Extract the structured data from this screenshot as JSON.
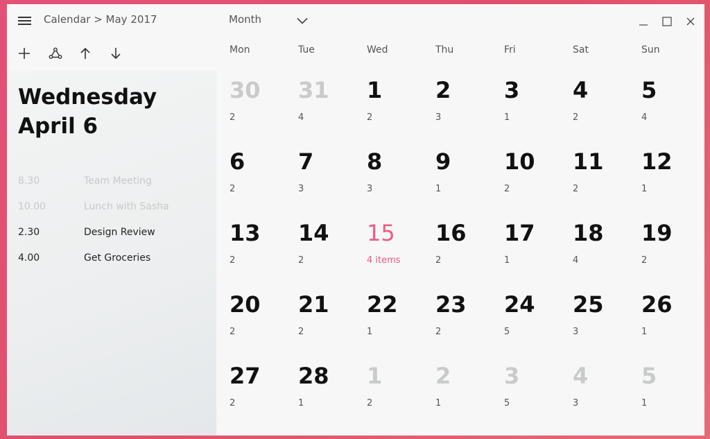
{
  "app": {
    "breadcrumb": "Calendar > May 2017",
    "view_label": "Month"
  },
  "toolbar": {
    "add_icon": "plus-icon",
    "share_icon": "share-icon",
    "up_icon": "arrow-up-icon",
    "down_icon": "arrow-down-icon"
  },
  "window_controls": [
    "minimize-icon",
    "maximize-icon",
    "close-icon"
  ],
  "day": {
    "weekday": "Wednesday",
    "date": "April 6"
  },
  "events": [
    {
      "time": "8.30",
      "title": "Team Meeting",
      "state": "past"
    },
    {
      "time": "10.00",
      "title": "Lunch with Sasha",
      "state": "past"
    },
    {
      "time": "2.30",
      "title": "Design Review",
      "state": "upcoming"
    },
    {
      "time": "4.00",
      "title": "Get Groceries",
      "state": "upcoming"
    }
  ],
  "weekdays": [
    "Mon",
    "Tue",
    "Wed",
    "Thu",
    "Fri",
    "Sat",
    "Sun"
  ],
  "weeks": [
    [
      {
        "day": "30",
        "count": "2",
        "other": true
      },
      {
        "day": "31",
        "count": "4",
        "other": true
      },
      {
        "day": "1",
        "count": "2"
      },
      {
        "day": "2",
        "count": "3"
      },
      {
        "day": "3",
        "count": "1"
      },
      {
        "day": "4",
        "count": "2"
      },
      {
        "day": "5",
        "count": "4"
      }
    ],
    [
      {
        "day": "6",
        "count": "2"
      },
      {
        "day": "7",
        "count": "3"
      },
      {
        "day": "8",
        "count": "3"
      },
      {
        "day": "9",
        "count": "1"
      },
      {
        "day": "10",
        "count": "2"
      },
      {
        "day": "11",
        "count": "2"
      },
      {
        "day": "12",
        "count": "1"
      }
    ],
    [
      {
        "day": "13",
        "count": "2"
      },
      {
        "day": "14",
        "count": "2"
      },
      {
        "day": "15",
        "count": "4 items",
        "today": true
      },
      {
        "day": "16",
        "count": "2"
      },
      {
        "day": "17",
        "count": "1"
      },
      {
        "day": "18",
        "count": "4"
      },
      {
        "day": "19",
        "count": "2"
      }
    ],
    [
      {
        "day": "20",
        "count": "2"
      },
      {
        "day": "21",
        "count": "2"
      },
      {
        "day": "22",
        "count": "1"
      },
      {
        "day": "23",
        "count": "2"
      },
      {
        "day": "24",
        "count": "5"
      },
      {
        "day": "25",
        "count": "3"
      },
      {
        "day": "26",
        "count": "1"
      }
    ],
    [
      {
        "day": "27",
        "count": "2"
      },
      {
        "day": "28",
        "count": "1"
      },
      {
        "day": "1",
        "count": "2",
        "other": true
      },
      {
        "day": "2",
        "count": "1",
        "other": true
      },
      {
        "day": "3",
        "count": "5",
        "other": true
      },
      {
        "day": "4",
        "count": "3",
        "other": true
      },
      {
        "day": "5",
        "count": "1",
        "other": true
      }
    ]
  ],
  "colors": {
    "accent": "#ec5a84",
    "background_gradient_start": "#e35078",
    "muted": "#c9cbcb"
  }
}
